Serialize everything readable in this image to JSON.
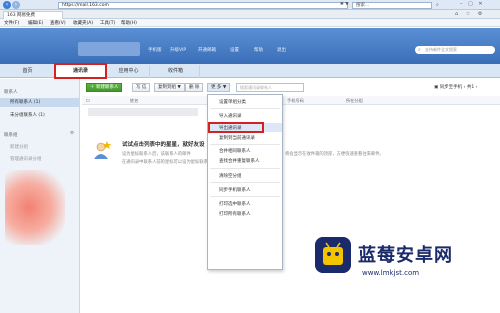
{
  "browser": {
    "back_icon": "arrow-left-icon",
    "forward_icon": "arrow-right-icon",
    "url": "https://mail.163.com",
    "url_tools": "✱ ▼",
    "search_placeholder": "搜索...",
    "tab_title": "163 网易免费",
    "window_controls": "– ▢ ✕",
    "menu": [
      "文件(F)",
      "编辑(E)",
      "查看(V)",
      "收藏夹(A)",
      "工具(T)",
      "帮助(H)"
    ]
  },
  "mail_header": {
    "nav": [
      "手机版",
      "升级VIP",
      "开通邮箱",
      "设置",
      "帮助",
      "退出"
    ],
    "search_placeholder": "支持邮件全文搜索"
  },
  "main_tabs": [
    {
      "label": "首页"
    },
    {
      "label": "通讯录"
    },
    {
      "label": "应用中心"
    },
    {
      "label": "收件箱"
    }
  ],
  "sidebar": {
    "section_contacts": "联系人",
    "all_contacts": "所有联系人 (1)",
    "ungrouped": "未分组联系人 (1)",
    "section_groups": "联系组",
    "new_group": "新建分组",
    "manage_groups": "管理通讯录分组"
  },
  "toolbar": {
    "new_contact": "新建联系人",
    "write_letter": "写 信",
    "copy_to": "复制到组 ▼",
    "delete": "删 除",
    "more": "更 多 ▼",
    "search_placeholder": "搜索通讯录联系人",
    "right_tools": "▣ 同步至手机  ‹ 共1  ›"
  },
  "list_header": {
    "name": "姓名",
    "email": "邮箱",
    "phone": "手机号码",
    "group": "所在分组"
  },
  "dropdown": {
    "items": [
      "设置单组分类",
      "导入通讯录",
      "导出通讯录",
      "复制到当前通讯录",
      "合并相同联系人",
      "查找合并重复联系人",
      "清除空分组",
      "同步手机联系人",
      "打印选中联系人",
      "打印所有联系人"
    ],
    "highlighted_index": 2
  },
  "empty_state": {
    "title": "试试点击列表中的星星，就好友设",
    "desc1": "设为星标联系人后，该联系人的邮件",
    "desc2": "在通讯录中联系人前的星标可以设为星标联系",
    "desc3": "将会显示在收件箱的顶部，方便快速查看往来邮件。"
  },
  "watermark": {
    "title": "蓝莓安卓网",
    "url": "www.lmkjst.com"
  },
  "colors": {
    "accent": "#3a6fb8",
    "highlight_box": "#d42222",
    "new_button": "#4aa634"
  }
}
